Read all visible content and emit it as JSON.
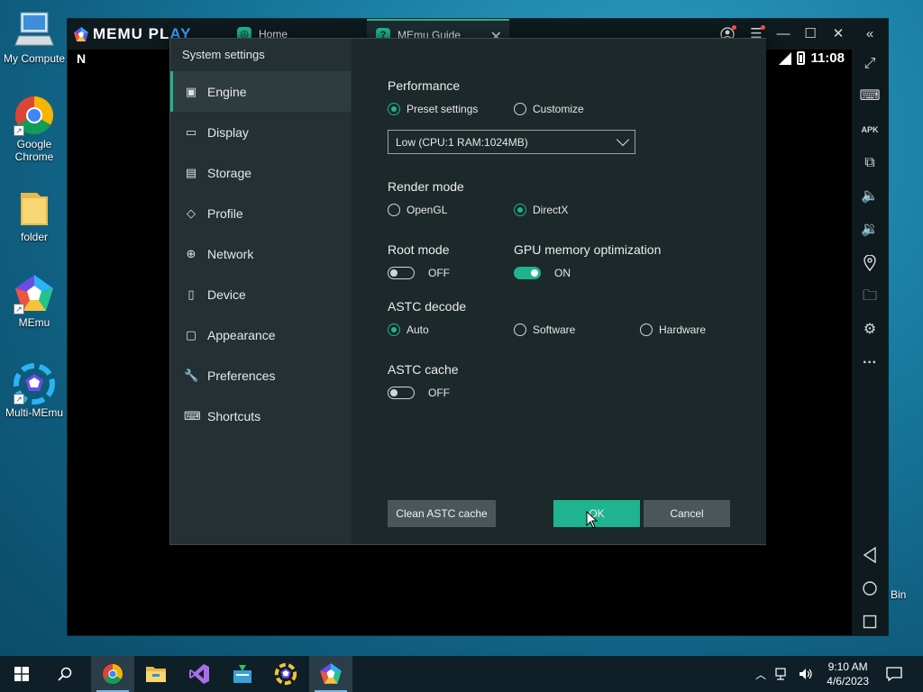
{
  "desktop": {
    "icons": [
      {
        "label": "My Compute"
      },
      {
        "label": "Google Chrome"
      },
      {
        "label": "folder"
      },
      {
        "label": "MEmu"
      },
      {
        "label": "Multi-MEmu"
      }
    ],
    "bin_label": "Bin"
  },
  "memu": {
    "logo_text_a": "MEMU PL",
    "logo_text_b": "AY",
    "tabs": [
      {
        "label": "Home",
        "icon": "home-tab-icon"
      },
      {
        "label": "MEmu Guide",
        "icon": "guide-tab-icon"
      }
    ],
    "android_status": {
      "time": "11:08",
      "left_icon": "N"
    }
  },
  "dialog": {
    "title": "System settings",
    "nav": [
      {
        "label": "Engine",
        "icon": "chip-icon",
        "active": true
      },
      {
        "label": "Display",
        "icon": "monitor-icon"
      },
      {
        "label": "Storage",
        "icon": "storage-icon"
      },
      {
        "label": "Profile",
        "icon": "tag-icon"
      },
      {
        "label": "Network",
        "icon": "globe-icon"
      },
      {
        "label": "Device",
        "icon": "phone-icon"
      },
      {
        "label": "Appearance",
        "icon": "window-icon"
      },
      {
        "label": "Preferences",
        "icon": "wrench-icon"
      },
      {
        "label": "Shortcuts",
        "icon": "keyboard-icon"
      }
    ],
    "performance": {
      "label": "Performance",
      "preset": "Preset settings",
      "customize": "Customize",
      "selected": "Low (CPU:1 RAM:1024MB)"
    },
    "render": {
      "label": "Render mode",
      "opengl": "OpenGL",
      "directx": "DirectX"
    },
    "root": {
      "label": "Root mode",
      "state": "OFF"
    },
    "gpu": {
      "label": "GPU memory optimization",
      "state": "ON"
    },
    "astc_decode": {
      "label": "ASTC decode",
      "auto": "Auto",
      "software": "Software",
      "hardware": "Hardware"
    },
    "astc_cache": {
      "label": "ASTC cache",
      "state": "OFF"
    },
    "buttons": {
      "clean": "Clean ASTC cache",
      "ok": "OK",
      "cancel": "Cancel"
    }
  },
  "taskbar": {
    "time": "9:10 AM",
    "date": "4/6/2023"
  },
  "colors": {
    "accent": "#1fb38f",
    "dialog_bg": "#243033",
    "content_bg": "#1d282b"
  }
}
